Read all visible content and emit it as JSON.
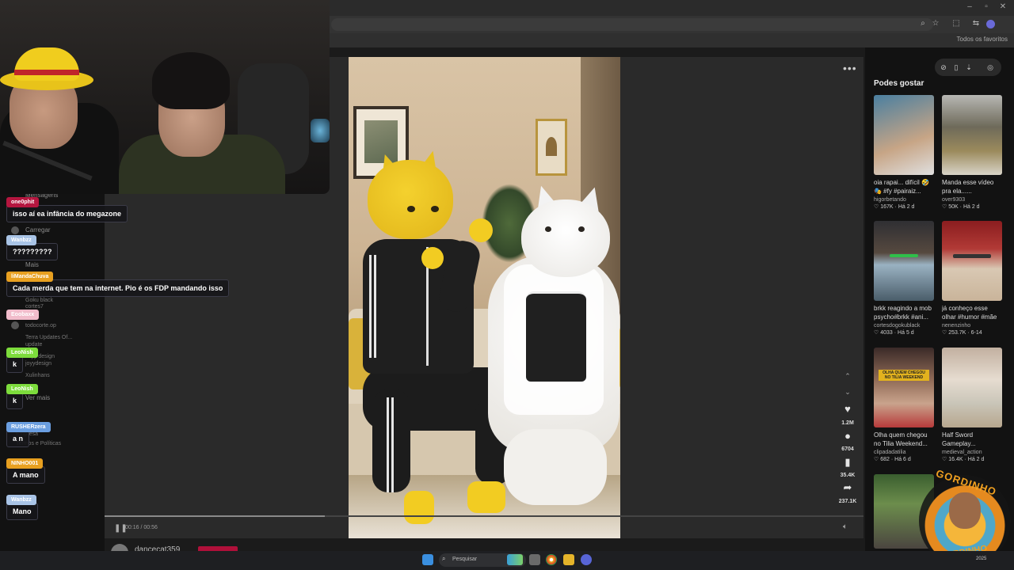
{
  "browser": {
    "bookmarks_all": "Todos os favoritos",
    "window_controls": [
      "–",
      "▫",
      "✕"
    ]
  },
  "sidenav": {
    "items": [
      {
        "label": "Mensagens",
        "icon": "message-icon"
      },
      {
        "label": "Carregar",
        "icon": "upload-icon"
      },
      {
        "label": "Mais",
        "icon": "more-icon"
      }
    ],
    "following": [
      {
        "name": "Goku black",
        "handle": "cortes7"
      },
      {
        "name": "todocorte.op",
        "handle": "todocorte.op"
      },
      {
        "name": "Terra Updates Of...",
        "handle": "update"
      },
      {
        "name": "Joyy design",
        "handle": "joyydesign"
      },
      {
        "name": "Xulinhans",
        "handle": ""
      }
    ],
    "see_more": "Ver mais",
    "footer": [
      "Empresa",
      "Termos e Políticas"
    ]
  },
  "chat": [
    {
      "user": "one0phit",
      "color": "#b5163f",
      "text": "isso aí ea infância do megazone"
    },
    {
      "user": "Wanbzz",
      "color": "#a9c4e6",
      "text": "?????????"
    },
    {
      "user": "liMandaChuva",
      "color": "#e8a020",
      "text": "Cada merda que tem na internet. Pio é os FDP mandando isso"
    },
    {
      "user": "Eoobaxx",
      "color": "#f1bccb",
      "text": ""
    },
    {
      "user": "LeoNish",
      "color": "#7ddc3c",
      "text": "k"
    },
    {
      "user": "LeoNish",
      "color": "#7ddc3c",
      "text": "k"
    },
    {
      "user": "RUSHERzera",
      "color": "#6a9ee0",
      "text": "a n"
    },
    {
      "user": "NINHO001",
      "color": "#e8a020",
      "text": "A mano"
    },
    {
      "user": "Wanbzz",
      "color": "#a9c4e6",
      "text": "Mano"
    }
  ],
  "player": {
    "time": "00:16 / 00:56",
    "progress": 0.29,
    "author": "dancecat359"
  },
  "actions": {
    "likes": "1.2M",
    "comments": "6704",
    "saves": "35.4K",
    "shares": "237.1K"
  },
  "sidebar": {
    "title": "Podes gostar",
    "cards": [
      {
        "title": "oia rapai... difícil 🤣 🎭 #fy #pairaiz...",
        "user": "higorbetando",
        "likes": "167K",
        "age": "Há 2 d"
      },
      {
        "title": "Manda esse vídeo pra ela......",
        "user": "over9303",
        "likes": "50K",
        "age": "Há 2 d"
      },
      {
        "title": "brkk reagindo a mob psycho#brkk #ani...",
        "user": "cortesdogokublack",
        "likes": "4033",
        "age": "Há 5 d"
      },
      {
        "title": "já conheço esse olhar #humor #mãe",
        "user": "nenenzinho",
        "likes": "253.7K",
        "age": "6-14"
      },
      {
        "title": "Olha quem chegou no Tilia Weekend...",
        "user": "clipadadatilia",
        "likes": "682",
        "age": "Há 6 d"
      },
      {
        "title": "Half Sword Gameplay...",
        "user": "medieval_action",
        "likes": "16.4K",
        "age": "Há 2 d"
      }
    ],
    "thumb_overlay": "OLHA QUEM CHEGOU NO TILIA WEEKEND"
  },
  "taskbar": {
    "search_placeholder": "Pesquisar",
    "date": "2025"
  },
  "logo": {
    "top_text": "GORDINHO",
    "bottom_text": "GORDINHO"
  }
}
